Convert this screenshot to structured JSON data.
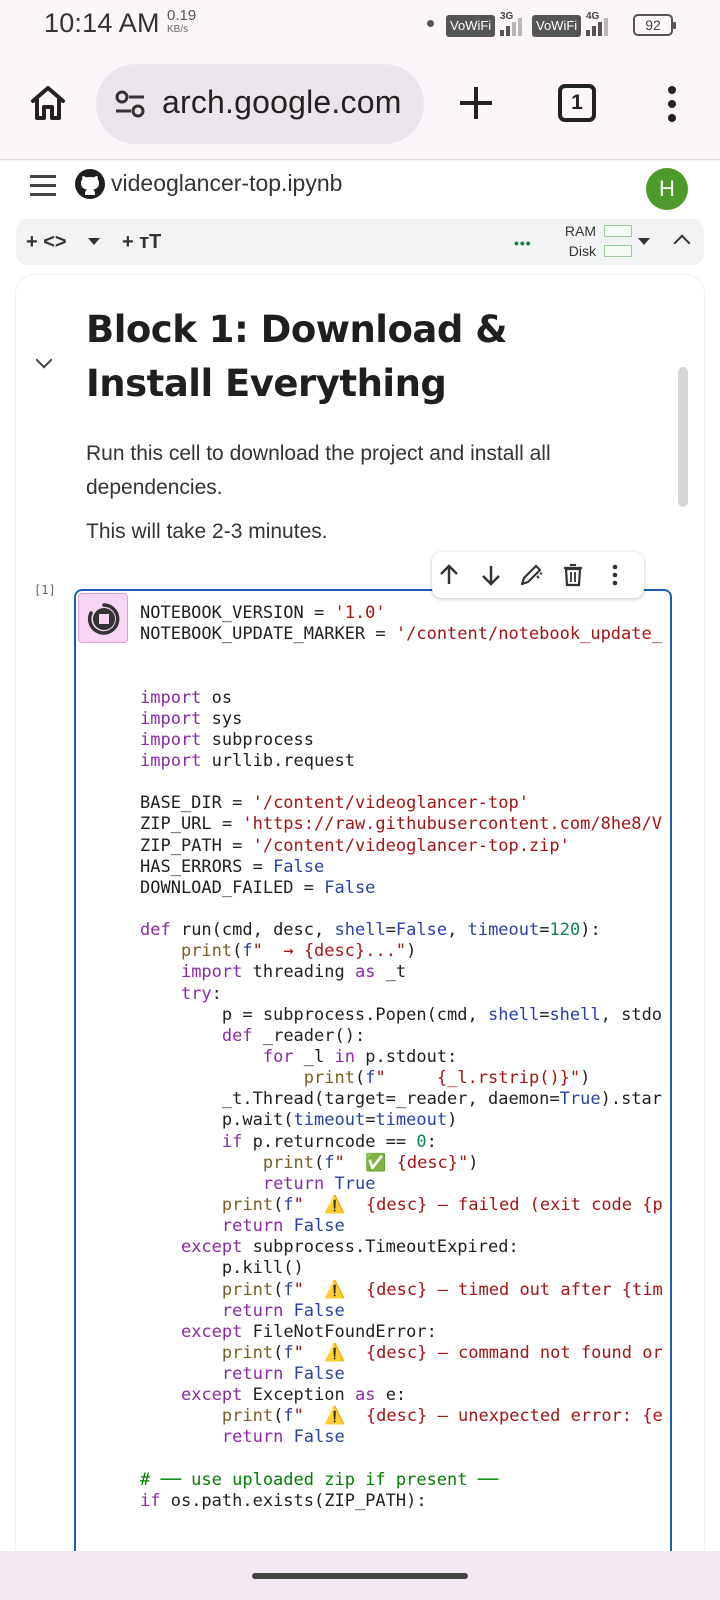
{
  "status_bar": {
    "time": "10:14 AM",
    "net_speed_value": "0.19",
    "net_speed_unit": "KB/s",
    "sim1_label": "VoWiFi",
    "sim1_net": "3G",
    "sim2_label": "VoWiFi",
    "sim2_net": "4G",
    "battery": "92"
  },
  "browser": {
    "url": "arch.google.com",
    "tab_count": "1"
  },
  "colab": {
    "notebook_title": "videoglancer-top.ipynb",
    "avatar_letter": "H",
    "toolbar": {
      "add_code": "+ <>",
      "add_text": "+ тT",
      "more": "•••",
      "ram_label": "RAM",
      "disk_label": "Disk"
    }
  },
  "markdown_cell": {
    "heading": "Block 1: Download & Install Everything",
    "paragraph1": "Run this cell to download the project and install all dependencies.",
    "paragraph2": "This will take 2-3 minutes."
  },
  "code_cell": {
    "execution_count": "[1]",
    "lines": [
      "NOTEBOOK_VERSION = '1.0'",
      "NOTEBOOK_UPDATE_MARKER = '/content/notebook_update_",
      "",
      "",
      "import os",
      "import sys",
      "import subprocess",
      "import urllib.request",
      "",
      "BASE_DIR = '/content/videoglancer-top'",
      "ZIP_URL = 'https://raw.githubusercontent.com/8he8/V",
      "ZIP_PATH = '/content/videoglancer-top.zip'",
      "HAS_ERRORS = False",
      "DOWNLOAD_FAILED = False",
      "",
      "def run(cmd, desc, shell=False, timeout=120):",
      "    print(f\"  → {desc}...\")",
      "    import threading as _t",
      "    try:",
      "        p = subprocess.Popen(cmd, shell=shell, stdo",
      "        def _reader():",
      "            for _l in p.stdout:",
      "                print(f\"     {_l.rstrip()}\")",
      "        _t.Thread(target=_reader, daemon=True).star",
      "        p.wait(timeout=timeout)",
      "        if p.returncode == 0:",
      "            print(f\"  ✅ {desc}\")",
      "            return True",
      "        print(f\"  ⚠️  {desc} — failed (exit code {p",
      "        return False",
      "    except subprocess.TimeoutExpired:",
      "        p.kill()",
      "        print(f\"  ⚠️  {desc} — timed out after {tim",
      "        return False",
      "    except FileNotFoundError:",
      "        print(f\"  ⚠️  {desc} — command not found or",
      "        return False",
      "    except Exception as e:",
      "        print(f\"  ⚠️  {desc} — unexpected error: {e",
      "        return False",
      "",
      "# ── use uploaded zip if present ──",
      "if os.path.exists(ZIP_PATH):"
    ]
  }
}
